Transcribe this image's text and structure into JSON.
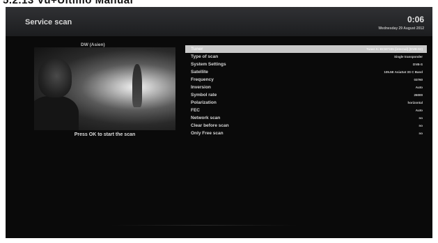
{
  "manual_heading": "5.2.13 Vu+Ultimo Manual",
  "header": {
    "title": "Service scan",
    "time": "0:06",
    "date": "Wednesday 29 August 2012"
  },
  "preview": {
    "channel_name": "DW (Asien)",
    "prompt": "Press OK to start the scan"
  },
  "menu": {
    "rows": [
      {
        "label": "Tuner",
        "value": "Tuner A: BCM7335 (internal) (DVB-S2)"
      },
      {
        "label": "Type of scan",
        "value": "Single transponder"
      },
      {
        "label": "System Settings",
        "value": "DVB-S"
      },
      {
        "label": "Satellite",
        "value": "105.5E AsiaSat 3S C Band"
      },
      {
        "label": "Frequency",
        "value": "03760"
      },
      {
        "label": "Inversion",
        "value": "Auto"
      },
      {
        "label": "Symbol rate",
        "value": "26000"
      },
      {
        "label": "Polarization",
        "value": "horizontal"
      },
      {
        "label": "FEC",
        "value": "Auto"
      },
      {
        "label": "Network scan",
        "value": "no"
      },
      {
        "label": "Clear before scan",
        "value": "no"
      },
      {
        "label": "Only Free scan",
        "value": "no"
      }
    ],
    "selected_index": 0
  }
}
